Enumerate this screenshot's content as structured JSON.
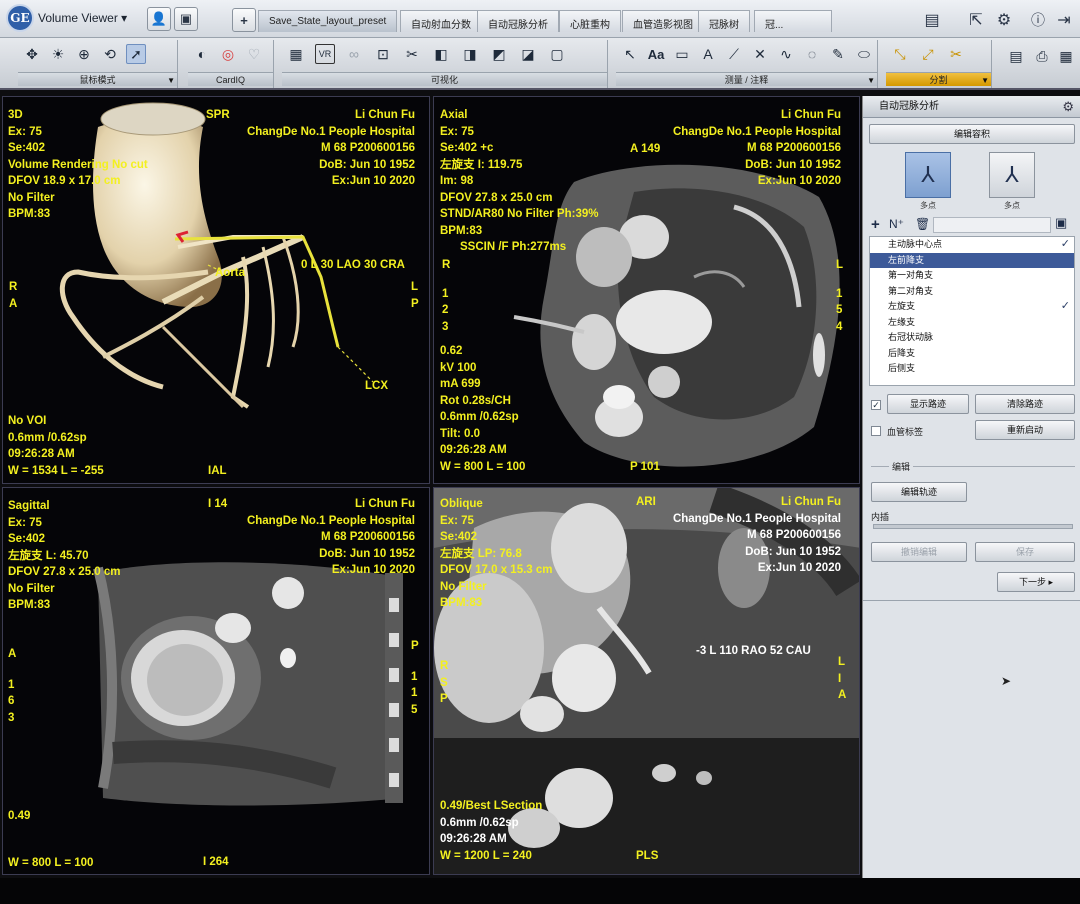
{
  "app": {
    "logo": "GE",
    "title": "Volume Viewer",
    "title_dropdown": "▾"
  },
  "tabs": [
    {
      "label": "Save_State_layout_preset",
      "active": true
    },
    {
      "label": "自动射血分数"
    },
    {
      "label": "自动冠脉分析"
    },
    {
      "label": "心脏重构"
    },
    {
      "label": "血管造影视图"
    },
    {
      "label": "冠脉树"
    },
    {
      "label": "冠..."
    }
  ],
  "toolbar": {
    "groups": [
      {
        "label": "鼠标模式"
      },
      {
        "label": "CardIQ"
      },
      {
        "label": "可视化"
      },
      {
        "label": "测量 / 注释"
      },
      {
        "label": "分割"
      }
    ],
    "icons": {
      "mouse": [
        "move-icon",
        "brightness-icon",
        "zoom-icon",
        "rotate-icon",
        "pointer-icon"
      ],
      "cardiq": [
        "cardiq-icon",
        "ring-icon",
        "heart-icon"
      ],
      "vis": [
        "layout-icon",
        "vr-icon",
        "link-icon",
        "fit-icon",
        "scissors-icon",
        "cube-icon",
        "cube-icon",
        "cube-icon",
        "cube-icon",
        "cube-icon"
      ],
      "measure": [
        "arrow-icon",
        "text-icon",
        "text-box-icon",
        "text-icon",
        "slash-icon",
        "cross-icon",
        "curve-icon",
        "lasso-icon",
        "brush-icon",
        "eraser-icon"
      ],
      "seg": [
        "vessel-icon",
        "vessel-plus-icon",
        "cut-icon"
      ]
    },
    "aa_label": "Aa"
  },
  "right_titlebar_icons": [
    "monitor-icon",
    "export-icon",
    "gear-icon",
    "help-icon",
    "exit-icon"
  ],
  "viewports": {
    "vr3d": {
      "tl": [
        "3D",
        "Ex: 75",
        "Se:402",
        "Volume Rendering No cut",
        "DFOV 18.9 x 17.0 cm",
        "No Filter",
        "BPM:83"
      ],
      "tr": [
        "Li Chun Fu",
        "ChangDe No.1 People Hospital",
        "M 68 P200600156",
        "DoB: Jun 10 1952",
        "Ex:Jun 10 2020"
      ],
      "top": "SPR",
      "orient": "0 L 30 LAO 30 CRA",
      "left": [
        "R",
        "A"
      ],
      "right": [
        "L",
        "P"
      ],
      "bl": [
        "No VOI",
        "0.6mm /0.62sp",
        "09:26:28 AM",
        "W = 1534 L = -255"
      ],
      "bottom": "IAL",
      "labels": {
        "aorta": "Aorta",
        "lcx": "LCX"
      }
    },
    "axial": {
      "tl": [
        "Axial",
        "Ex: 75",
        "Se:402 +c",
        "左旋支 I: 119.75",
        "Im: 98",
        "DFOV 27.8 x 25.0 cm",
        "STND/AR80 No Filter Ph:39%",
        "BPM:83",
        "SSCIN /F Ph:277ms"
      ],
      "tr": [
        "Li Chun Fu",
        "ChangDe No.1 People Hospital",
        "M 68 P200600156",
        "DoB: Jun 10 1952",
        "Ex:Jun 10 2020"
      ],
      "top": "A 149",
      "left": [
        "R",
        "1",
        "2",
        "3"
      ],
      "right": [
        "L",
        "1",
        "5",
        "4"
      ],
      "bl": [
        "0.62",
        "kV 100",
        "mA 699",
        "Rot 0.28s/CH",
        "0.6mm /0.62sp",
        "Tilt: 0.0",
        "09:26:28 AM",
        "W = 800 L = 100"
      ],
      "bottom": "P 101"
    },
    "sagittal": {
      "tl": [
        "Sagittal",
        "Ex: 75",
        "Se:402",
        "左旋支 L: 45.70",
        "DFOV 27.8 x 25.0 cm",
        "No Filter",
        "BPM:83"
      ],
      "tr": [
        "Li Chun Fu",
        "ChangDe No.1 People Hospital",
        "M 68 P200600156",
        "DoB: Jun 10 1952",
        "Ex:Jun 10 2020"
      ],
      "top": "I 14",
      "left": [
        "A",
        "1",
        "6",
        "3"
      ],
      "right": [
        "P",
        "1",
        "1",
        "5"
      ],
      "bl": [
        "0.49",
        "W = 800 L = 100"
      ],
      "bottom": "I 264"
    },
    "oblique": {
      "tl": [
        "Oblique",
        "Ex: 75",
        "Se:402",
        "左旋支 LP: 76.8",
        "DFOV 17.0 x 15.3 cm",
        "No Filter",
        "BPM:83"
      ],
      "tr": [
        "Li Chun Fu",
        "ChangDe No.1 People Hospital",
        "M 68 P200600156",
        "DoB: Jun 10 1952",
        "Ex:Jun 10 2020"
      ],
      "top": "ARI",
      "orient": "-3 L 110 RAO 52 CAU",
      "left": [
        "R",
        "S",
        "P"
      ],
      "right": [
        "L",
        "I",
        "A"
      ],
      "bl": [
        "0.49/Best LSection",
        "0.6mm /0.62sp",
        "09:26:28 AM",
        "W = 1200 L = 240"
      ],
      "bottom": "PLS"
    }
  },
  "panel": {
    "title": "自动冠脉分析",
    "edit_volume": "编辑容积",
    "tool1_label": "多点",
    "tool2_label": "多点",
    "list": [
      {
        "label": "主动脉中心点",
        "checked": true
      },
      {
        "label": "左前降支",
        "selected": true
      },
      {
        "label": "第一对角支"
      },
      {
        "label": "第二对角支"
      },
      {
        "label": "左旋支",
        "checked": true
      },
      {
        "label": "左缘支"
      },
      {
        "label": "右冠状动脉"
      },
      {
        "label": "后降支"
      },
      {
        "label": "后侧支"
      }
    ],
    "show_path": "显示路迹",
    "clear_path": "清除路迹",
    "vessel_label": "血管标签",
    "restart": "重新启动",
    "edit_section": "编辑",
    "edit_path": "编辑轨迹",
    "inner_label": "内插",
    "cancel_edit": "撤销编辑",
    "save": "保存",
    "next": "下一步 ▸",
    "checkmark": "✓"
  }
}
